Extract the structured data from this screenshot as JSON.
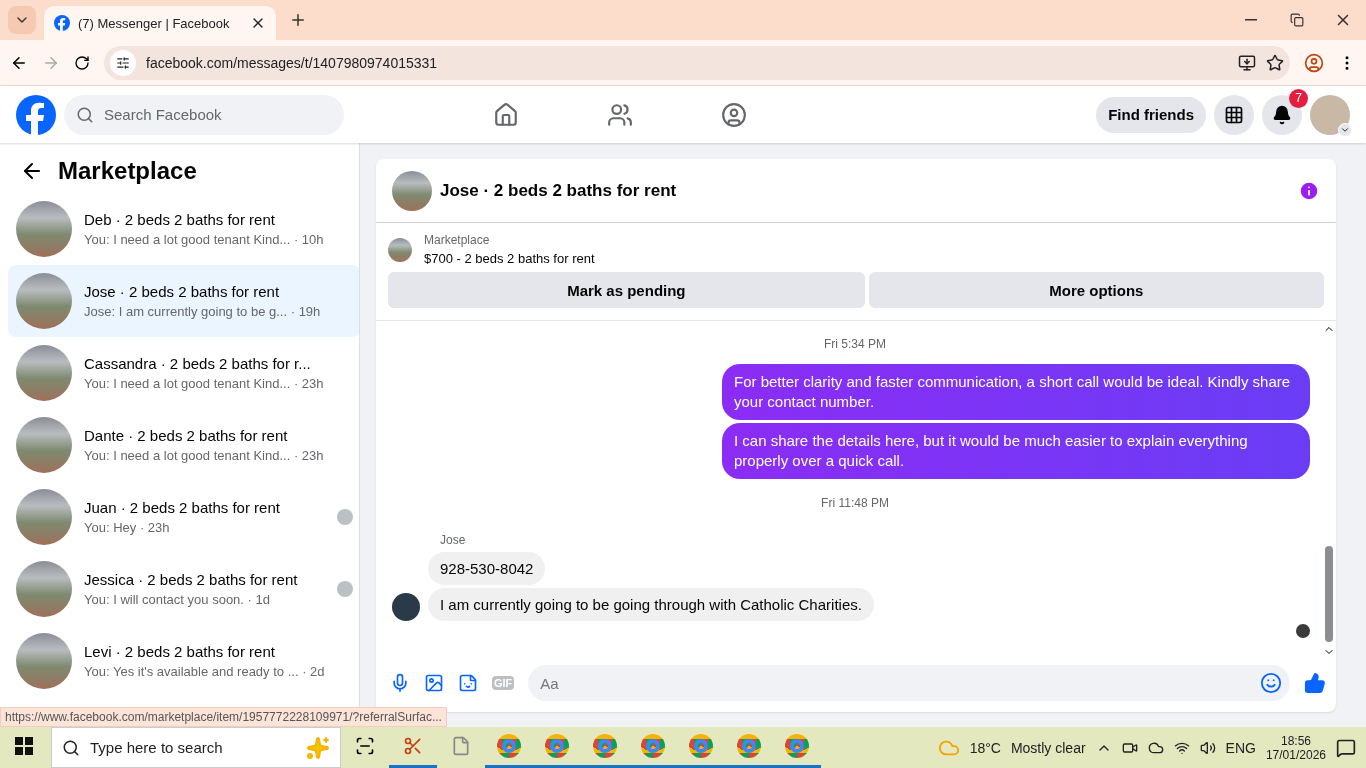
{
  "browser": {
    "tab_title": "(7) Messenger | Facebook",
    "url": "facebook.com/messages/t/1407980974015331",
    "status_url": "https://www.facebook.com/marketplace/item/1957772228109971/?referralSurfac..."
  },
  "header": {
    "search_placeholder": "Search Facebook",
    "find_friends": "Find friends",
    "notification_count": "7"
  },
  "sidebar": {
    "title": "Marketplace",
    "conversations": [
      {
        "name": "Deb · 2 beds 2 baths for rent",
        "preview": "You: I need a lot good tenant Kind...",
        "time": "· 10h",
        "selected": false,
        "seen": false
      },
      {
        "name": "Jose · 2 beds 2 baths for rent",
        "preview": "Jose: I am currently going to be g...",
        "time": "· 19h",
        "selected": true,
        "seen": false
      },
      {
        "name": "Cassandra · 2 beds 2 baths for r...",
        "preview": "You: I need a lot good tenant Kind...",
        "time": "· 23h",
        "selected": false,
        "seen": false
      },
      {
        "name": "Dante · 2 beds 2 baths for rent",
        "preview": "You: I need a lot good tenant Kind...",
        "time": "· 23h",
        "selected": false,
        "seen": false
      },
      {
        "name": "Juan · 2 beds 2 baths for rent",
        "preview": "You: Hey",
        "time": "· 23h",
        "selected": false,
        "seen": true
      },
      {
        "name": "Jessica · 2 beds 2 baths for rent",
        "preview": "You: I will contact you soon.",
        "time": "· 1d",
        "selected": false,
        "seen": true
      },
      {
        "name": "Levi · 2 beds 2 baths for rent",
        "preview": "You: Yes it's available and ready to ...",
        "time": "· 2d",
        "selected": false,
        "seen": false
      }
    ]
  },
  "chat": {
    "title": "Jose · 2 beds 2 baths for rent",
    "listing_label": "Marketplace",
    "listing_title": "$700 - 2 beds 2 baths for rent",
    "buttons": [
      "Mark as pending",
      "More options"
    ],
    "messages": [
      {
        "kind": "timestamp",
        "text": "Fri 5:34 PM"
      },
      {
        "kind": "outgoing",
        "text": "For better clarity and faster communication, a short call would be ideal. Kindly share your contact number."
      },
      {
        "kind": "outgoing",
        "text": "I can share the details here, but it would be much easier to explain everything properly over a quick call."
      },
      {
        "kind": "timestamp",
        "text": "Fri 11:48 PM"
      },
      {
        "kind": "sender",
        "text": "Jose"
      },
      {
        "kind": "incoming",
        "text": "928-530-8042"
      },
      {
        "kind": "incoming",
        "text": "I am currently going to be going through with Catholic Charities."
      }
    ],
    "composer_placeholder": "Aa",
    "gif_label": "GIF"
  },
  "taskbar": {
    "search_placeholder": "Type here to search",
    "temperature": "18°C",
    "weather": "Mostly clear",
    "language": "ENG",
    "time": "18:56",
    "date": "17/01/2026"
  }
}
